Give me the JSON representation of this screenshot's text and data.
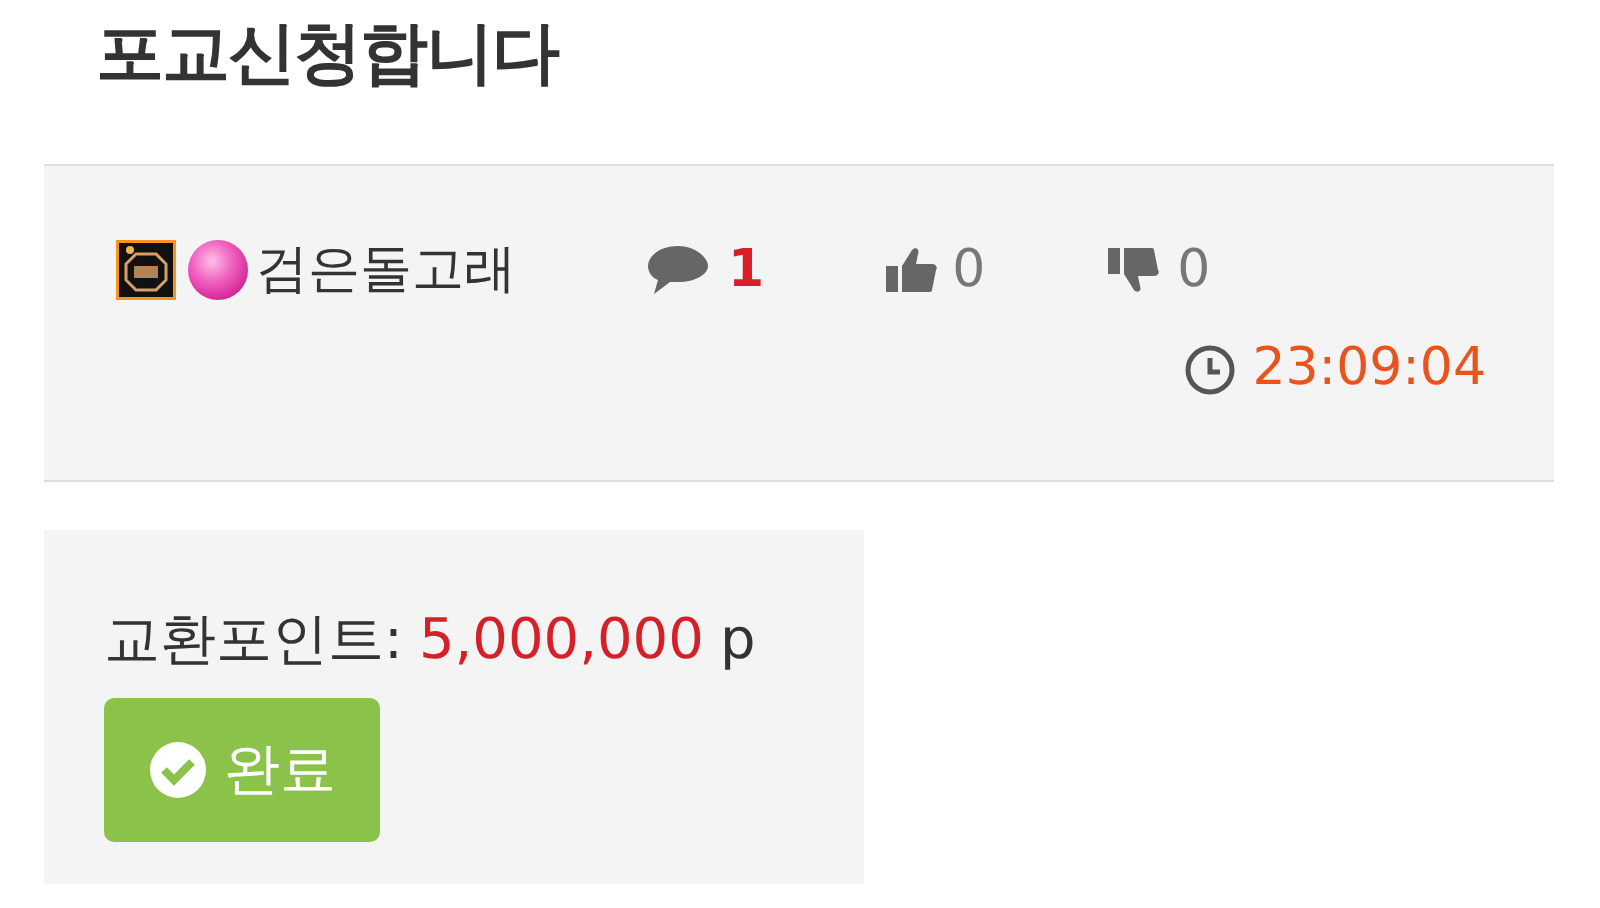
{
  "title": "포교신청합니다",
  "meta": {
    "author": "검은돌고래",
    "comments": "1",
    "likes": "0",
    "dislikes": "0",
    "time": "23:09:04"
  },
  "points": {
    "label": "교환포인트:",
    "value": "5,000,000",
    "unit": "p"
  },
  "status_button": {
    "label": "완료"
  }
}
